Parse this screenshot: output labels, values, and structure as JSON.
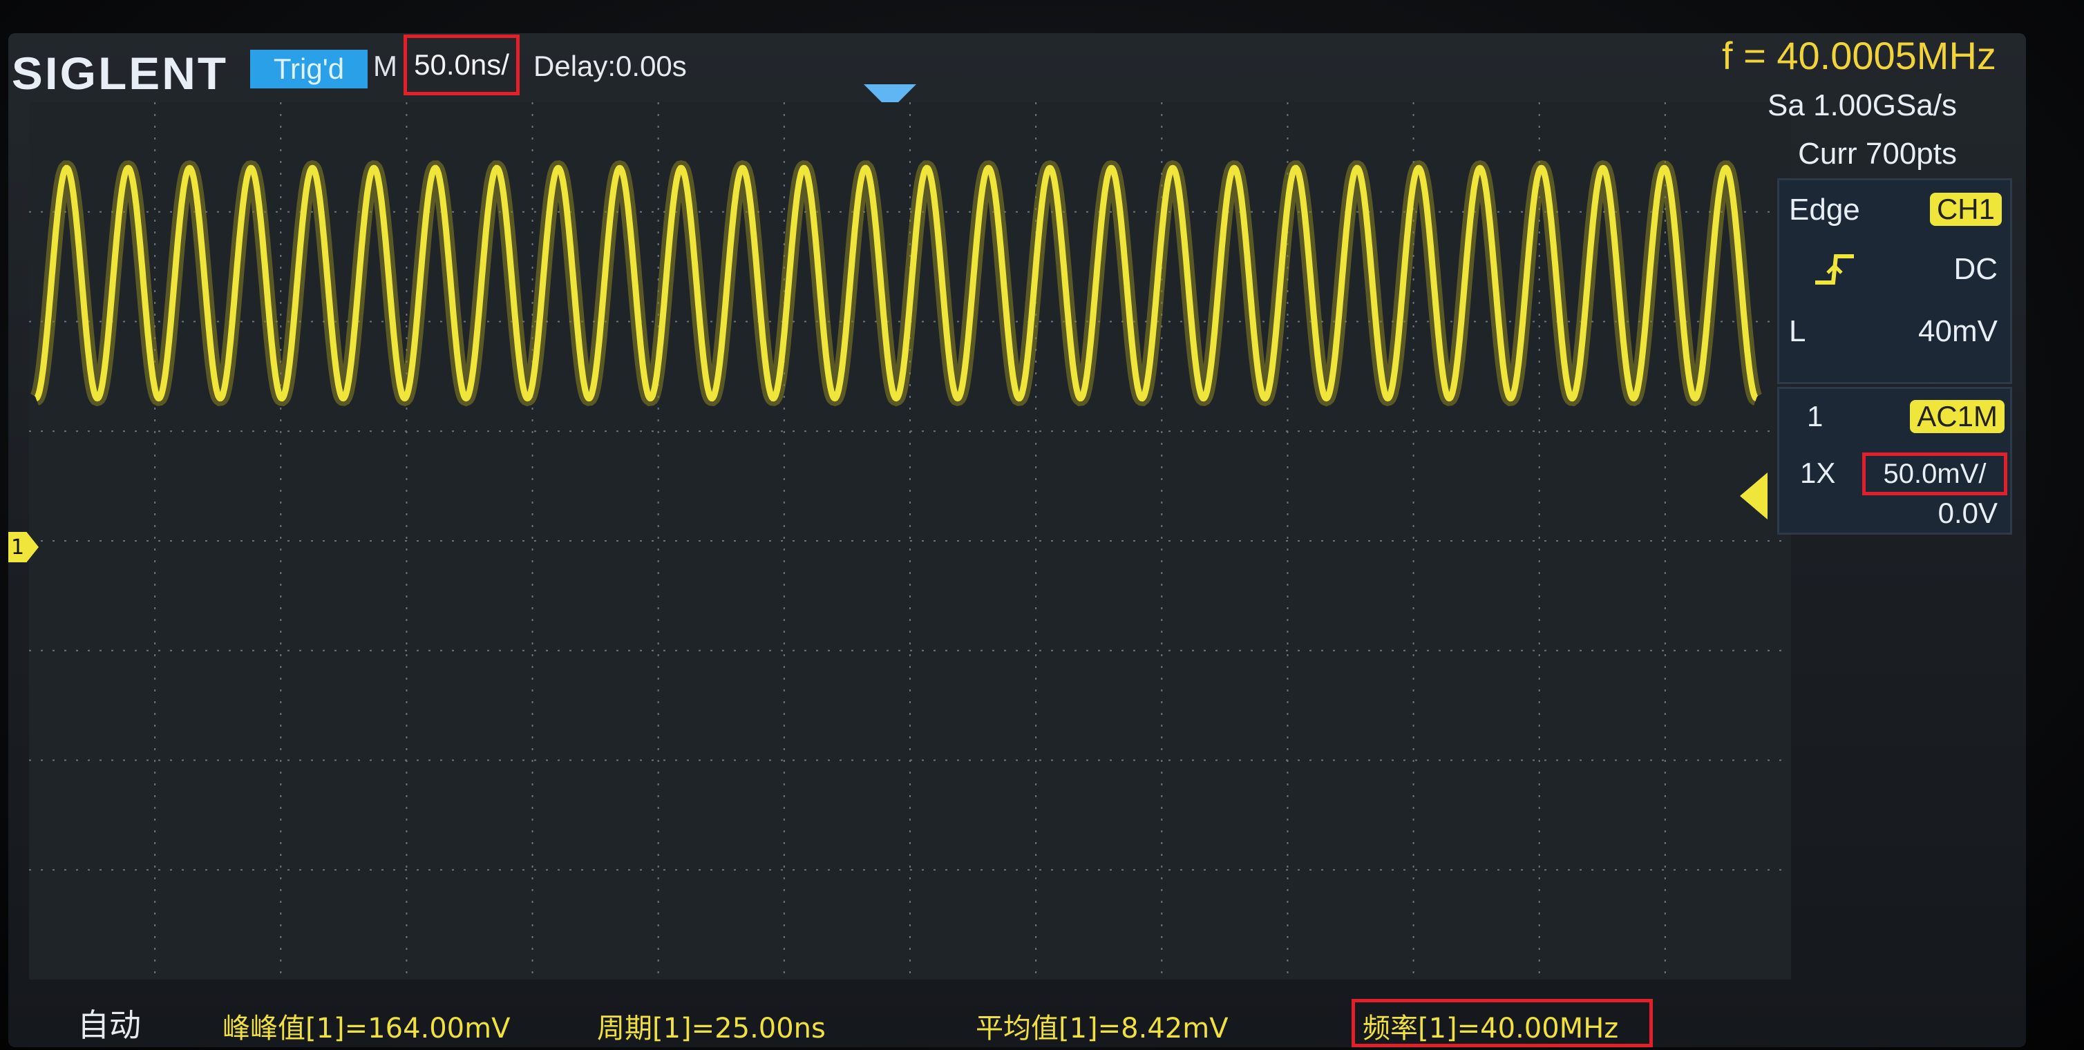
{
  "brand": "SIGLENT",
  "status": "Trig'd",
  "timebase": {
    "prefix": "M",
    "value": "50.0ns/",
    "delay": "Delay:0.00s"
  },
  "frequency_readout": "f = 40.0005MHz",
  "acquisition": {
    "sample_rate": "Sa 1.00GSa/s",
    "points": "Curr 700pts"
  },
  "trigger": {
    "type": "Edge",
    "source": "CH1",
    "slope_icon": "rising-edge-icon",
    "coupling": "DC",
    "level_label": "L",
    "level": "40mV"
  },
  "channel1": {
    "number": "1",
    "coupling": "AC1M",
    "probe": "1X",
    "scale": "50.0mV/",
    "offset": "0.0V",
    "marker": "1"
  },
  "mode": "自动",
  "measurements": [
    {
      "label": "峰峰值[1]=164.00mV"
    },
    {
      "label": "周期[1]=25.00ns"
    },
    {
      "label": "平均值[1]=8.42mV"
    },
    {
      "label": "频率[1]=40.00MHz"
    }
  ],
  "colors": {
    "trace": "#f0e53a",
    "highlight": "#e3202a",
    "trig_badge": "#2aa0e8",
    "panel": "#1c2836"
  },
  "waveform": {
    "cycles_visible": 28,
    "frequency_mhz": 40.0,
    "peak_to_peak_mv": 164.0
  }
}
